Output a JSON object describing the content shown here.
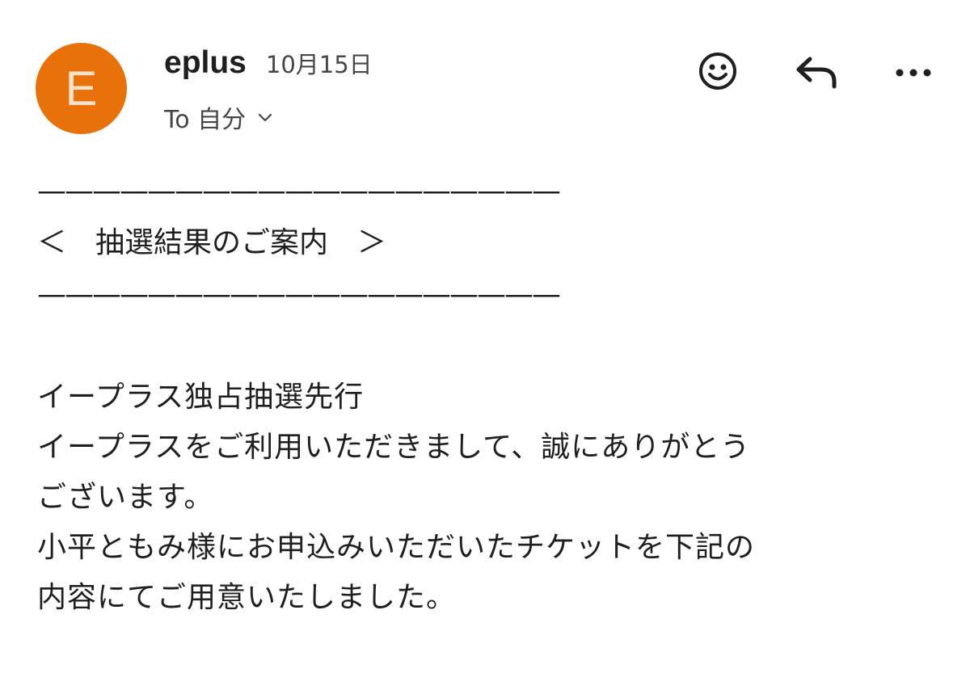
{
  "sender": {
    "avatar_letter": "E",
    "avatar_color": "#e8710a",
    "name": "eplus",
    "date": "10月15日",
    "recipient": "To 自分"
  },
  "actions": {
    "emoji_icon": "smiley-face-icon",
    "reply_icon": "reply-arrow-icon",
    "more_icon": "more-horizontal-icon"
  },
  "message": {
    "rule_top": "———————————————————",
    "title_line": "＜　抽選結果のご案内　＞",
    "rule_bottom": "———————————————————",
    "lines": [
      "イープラス独占抽選先行",
      "イープラスをご利用いただきまして、誠にありがとう",
      "ございます。",
      "小平ともみ様にお申込みいただいたチケットを下記の",
      "内容にてご用意いたしました。"
    ]
  }
}
